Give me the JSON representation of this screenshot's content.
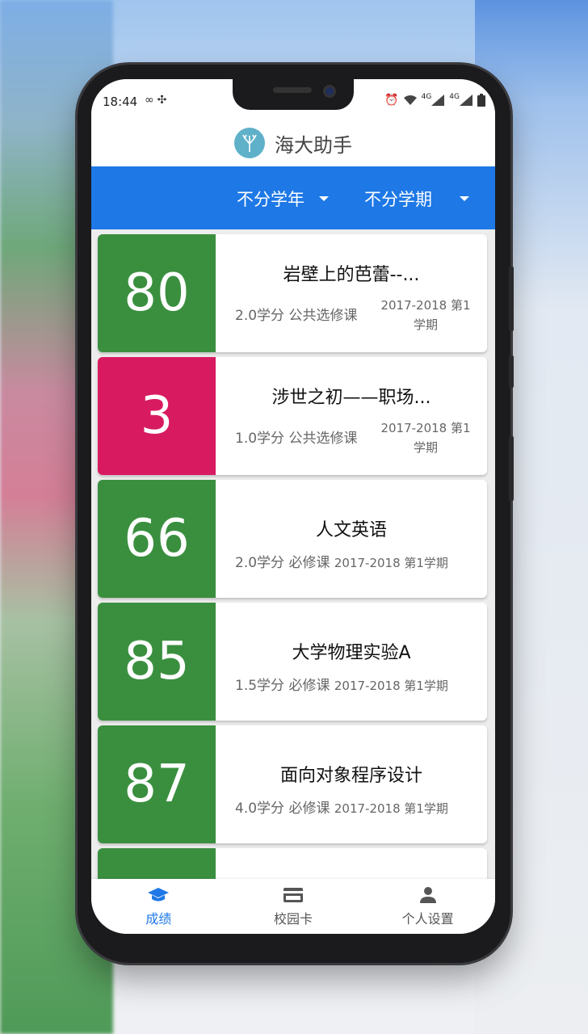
{
  "status_bar": {
    "time": "18:44",
    "net_1": "4G",
    "net_2": "4G"
  },
  "app": {
    "title": "海大助手",
    "logo_icon": "tree-icon"
  },
  "filters": {
    "year": "不分学年",
    "term": "不分学期"
  },
  "colors": {
    "pass": "#3a8f3f",
    "fail": "#d81b60",
    "accent": "#1e78e6"
  },
  "grades": [
    {
      "score": "80",
      "course": "岩壁上的芭蕾--...",
      "credits": "2.0学分",
      "type": "公共选修课",
      "semester": "2017-2018 第1学期",
      "status": "pass"
    },
    {
      "score": "3",
      "course": "涉世之初——职场...",
      "credits": "1.0学分",
      "type": "公共选修课",
      "semester": "2017-2018 第1学期",
      "status": "fail"
    },
    {
      "score": "66",
      "course": "人文英语",
      "credits": "2.0学分",
      "type": "必修课",
      "semester": "2017-2018 第1学期",
      "status": "pass"
    },
    {
      "score": "85",
      "course": "大学物理实验A",
      "credits": "1.5学分",
      "type": "必修课",
      "semester": "2017-2018 第1学期",
      "status": "pass"
    },
    {
      "score": "87",
      "course": "面向对象程序设计",
      "credits": "4.0学分",
      "type": "必修课",
      "semester": "2017-2018 第1学期",
      "status": "pass"
    }
  ],
  "nav": [
    {
      "label": "成绩",
      "icon": "graduation-cap-icon",
      "active": true
    },
    {
      "label": "校园卡",
      "icon": "credit-card-icon",
      "active": false
    },
    {
      "label": "个人设置",
      "icon": "person-icon",
      "active": false
    }
  ]
}
